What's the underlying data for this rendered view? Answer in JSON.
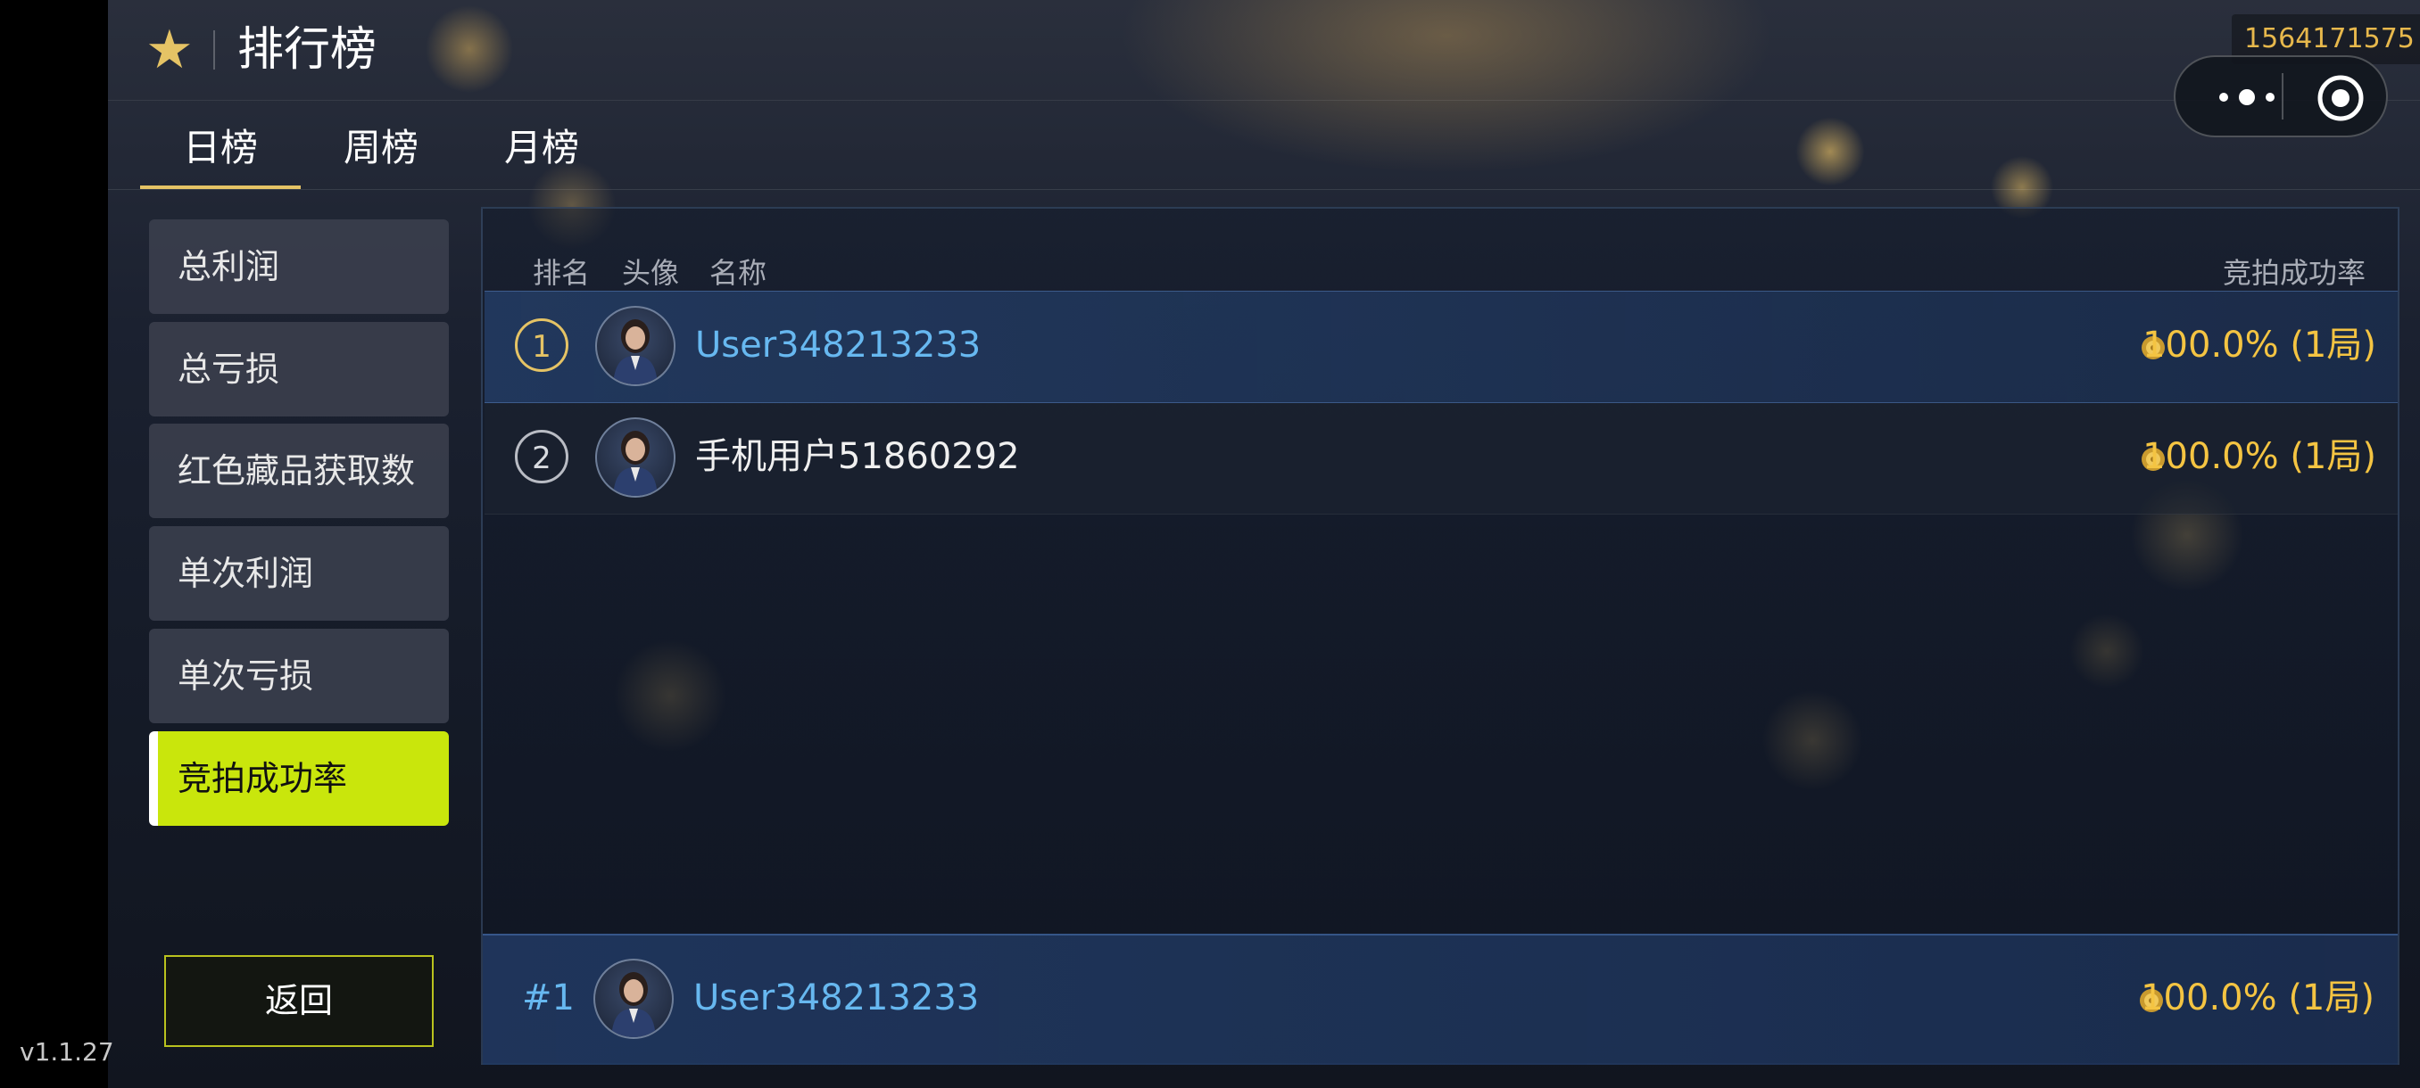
{
  "header": {
    "title": "排行榜",
    "star_icon": "star-icon",
    "uid": "1564171575",
    "capsule_more_icon": "more-dots-icon",
    "capsule_close_icon": "target-close-icon"
  },
  "tabs": [
    {
      "label": "日榜",
      "active": true
    },
    {
      "label": "周榜",
      "active": false
    },
    {
      "label": "月榜",
      "active": false
    }
  ],
  "sidebar": {
    "items": [
      {
        "label": "总利润",
        "active": false
      },
      {
        "label": "总亏损",
        "active": false
      },
      {
        "label": "红色藏品获取数",
        "active": false
      },
      {
        "label": "单次利润",
        "active": false
      },
      {
        "label": "单次亏损",
        "active": false
      },
      {
        "label": "竞拍成功率",
        "active": true
      }
    ],
    "back_label": "返回"
  },
  "table": {
    "columns": {
      "rank": "排名",
      "avatar": "头像",
      "name": "名称",
      "metric": "竞拍成功率"
    },
    "rows": [
      {
        "rank": "1",
        "name": "User348213233",
        "score": "100.0% (1局)"
      },
      {
        "rank": "2",
        "name": "手机用户51860292",
        "score": "100.0% (1局)"
      }
    ],
    "my_rank": {
      "rank_label": "#1",
      "name": "User348213233",
      "score": "100.0% (1局)"
    }
  },
  "colors": {
    "accent_gold": "#e5c365",
    "active_lime": "#c9e60c",
    "name_blue": "#67b8f0",
    "score_gold": "#f4c442"
  },
  "version": "v1.1.27"
}
